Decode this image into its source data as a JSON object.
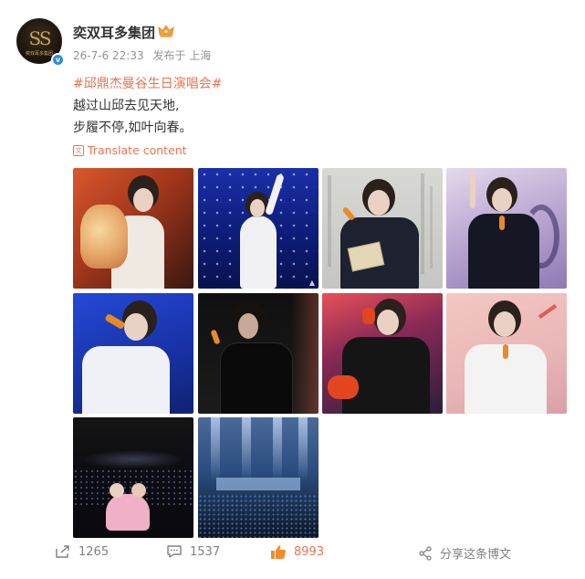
{
  "user": {
    "name": "奕双耳多集团",
    "avatar_mark": "SS",
    "avatar_text": "奕双耳多集团",
    "verified_mark": "v"
  },
  "meta": {
    "time": "26-7-6 22:33",
    "source": "发布于 上海"
  },
  "post": {
    "topic": "#邱鼎杰曼谷生日演唱会#",
    "lines": [
      "越过山邱去见天地,",
      "步履不停,如叶向春。"
    ],
    "translate_label": "Translate content"
  },
  "photos": [
    {
      "id": "photo-1",
      "theme": "bouquet"
    },
    {
      "id": "photo-2",
      "theme": "blue-stage-wave"
    },
    {
      "id": "photo-3",
      "theme": "calligraphy-book"
    },
    {
      "id": "photo-4",
      "theme": "purple-point"
    },
    {
      "id": "photo-5",
      "theme": "white-suit-sing"
    },
    {
      "id": "photo-6",
      "theme": "dark-sing"
    },
    {
      "id": "photo-7",
      "theme": "leather-boxing"
    },
    {
      "id": "photo-8",
      "theme": "white-jacket-pink"
    },
    {
      "id": "photo-9",
      "theme": "hall-crowd"
    },
    {
      "id": "photo-10",
      "theme": "stage-lights"
    }
  ],
  "actions": {
    "repost_count": "1265",
    "comment_count": "1537",
    "like_count": "8993",
    "share_label": "分享这条博文"
  },
  "colors": {
    "accent": "#eb7350",
    "meta_gray": "#939393",
    "verified_blue": "#2e8ae6"
  }
}
